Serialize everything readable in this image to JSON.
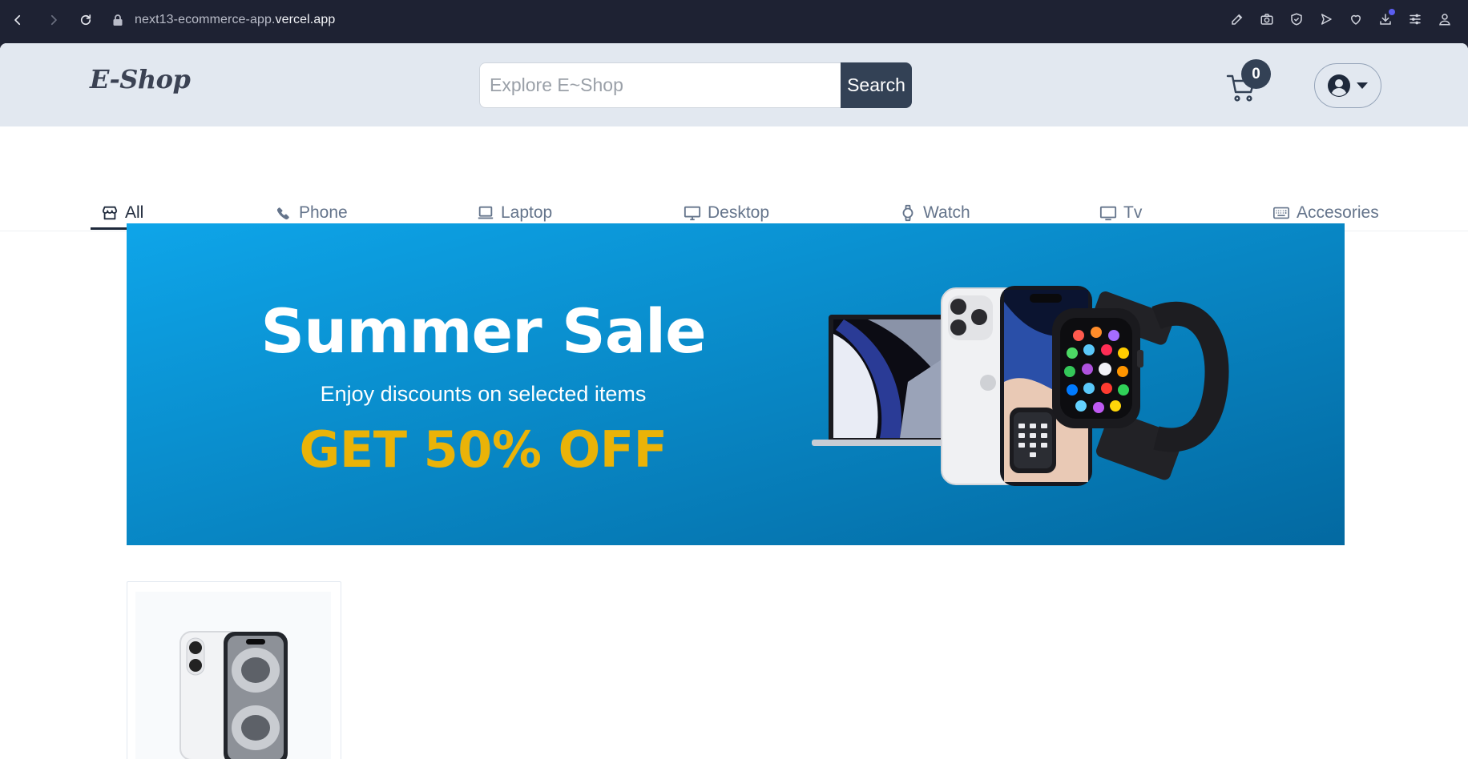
{
  "browser": {
    "url_prefix": "next13-ecommerce-app.",
    "url_domain": "vercel.app"
  },
  "header": {
    "logo": "E-Shop",
    "search_placeholder": "Explore E~Shop",
    "search_button": "Search",
    "cart_count": "0"
  },
  "categories": [
    {
      "label": "All",
      "icon": "store-icon",
      "active": true
    },
    {
      "label": "Phone",
      "icon": "phone-icon",
      "active": false
    },
    {
      "label": "Laptop",
      "icon": "laptop-icon",
      "active": false
    },
    {
      "label": "Desktop",
      "icon": "desktop-icon",
      "active": false
    },
    {
      "label": "Watch",
      "icon": "watch-icon",
      "active": false
    },
    {
      "label": "Tv",
      "icon": "tv-icon",
      "active": false
    },
    {
      "label": "Accesories",
      "icon": "keyboard-icon",
      "active": false
    }
  ],
  "banner": {
    "title": "Summer Sale",
    "subtitle": "Enjoy discounts on selected items",
    "offer": "GET 50% OFF",
    "image": "laptop-phone-watch-illustration"
  },
  "colors": {
    "header_bg": "#e2e8f0",
    "button_dark": "#334155",
    "banner_from": "#0ea5e9",
    "banner_to": "#0369a1",
    "offer_yellow": "#eab308"
  },
  "products": [
    {
      "image": "smartphone-product-image"
    }
  ]
}
